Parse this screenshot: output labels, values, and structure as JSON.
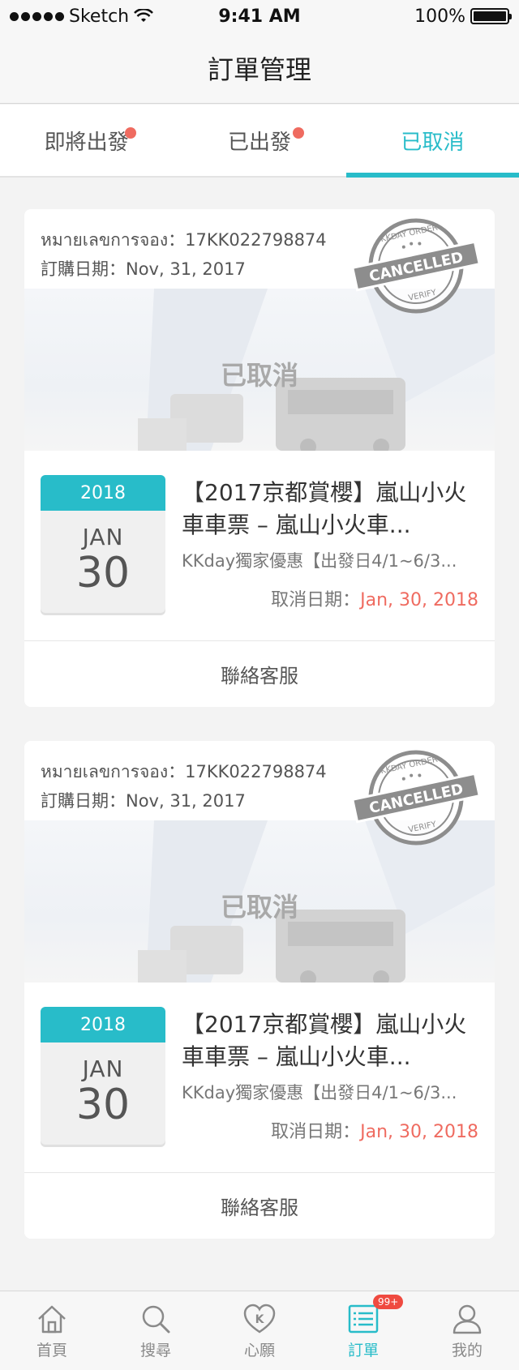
{
  "status_bar": {
    "carrier": "Sketch",
    "time": "9:41 AM",
    "battery": "100%"
  },
  "nav": {
    "title": "訂單管理"
  },
  "tabs": [
    {
      "label": "即將出發",
      "dot": true,
      "active": false
    },
    {
      "label": "已出發",
      "dot": true,
      "active": false
    },
    {
      "label": "已取消",
      "dot": false,
      "active": true
    }
  ],
  "orders": [
    {
      "booking_line": "หมายเลขการจอง：17KK022798874",
      "purchase_line": "訂購日期：Nov, 31, 2017",
      "stamp": {
        "top": "KKDAY ORDER",
        "middle": "CANCELLED",
        "bottom": "VERIFY"
      },
      "banner_status": "已取消",
      "date": {
        "year": "2018",
        "month": "JAN",
        "day": "30"
      },
      "title": "【2017京都賞櫻】嵐山小火車車票 – 嵐山小火車...",
      "subtitle": "KKday獨家優惠【出發日4/1~6/3...",
      "cancel_label": "取消日期：",
      "cancel_date": "Jan, 30, 2018",
      "contact": "聯絡客服"
    },
    {
      "booking_line": "หมายเลขการจอง：17KK022798874",
      "purchase_line": "訂購日期：Nov, 31, 2017",
      "stamp": {
        "top": "KKDAY ORDER",
        "middle": "CANCELLED",
        "bottom": "VERIFY"
      },
      "banner_status": "已取消",
      "date": {
        "year": "2018",
        "month": "JAN",
        "day": "30"
      },
      "title": "【2017京都賞櫻】嵐山小火車車票 – 嵐山小火車...",
      "subtitle": "KKday獨家優惠【出發日4/1~6/3...",
      "cancel_label": "取消日期：",
      "cancel_date": "Jan, 30, 2018",
      "contact": "聯絡客服"
    }
  ],
  "tabbar": [
    {
      "label": "首頁",
      "icon": "home-icon",
      "active": false
    },
    {
      "label": "搜尋",
      "icon": "search-icon",
      "active": false
    },
    {
      "label": "心願",
      "icon": "heart-k-icon",
      "active": false
    },
    {
      "label": "訂單",
      "icon": "order-list-icon",
      "active": true,
      "badge": "99+"
    },
    {
      "label": "我的",
      "icon": "profile-icon",
      "active": false
    }
  ],
  "colors": {
    "accent": "#28bcc9",
    "alert": "#ef6b60",
    "badge": "#ef4a40"
  }
}
